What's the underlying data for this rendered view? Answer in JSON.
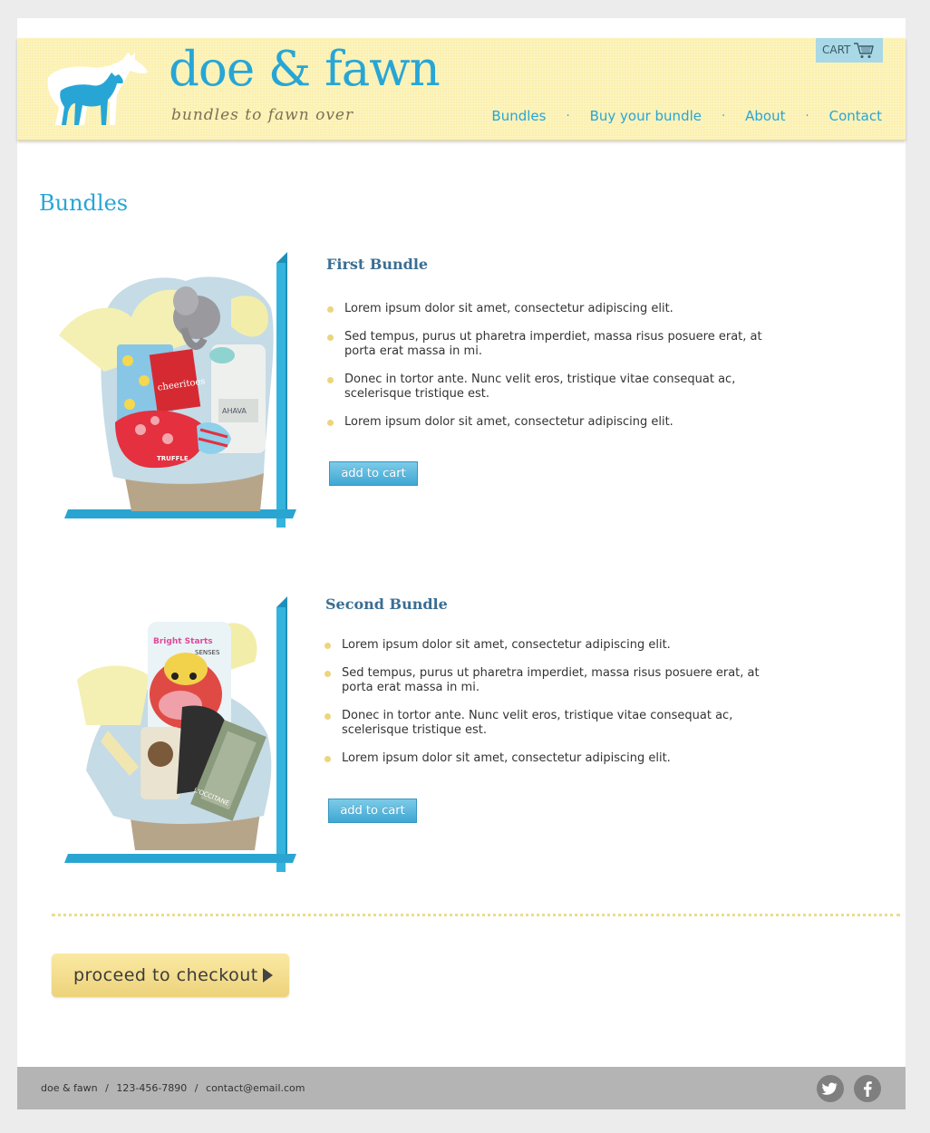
{
  "brand": {
    "name": "doe & fawn",
    "tagline": "bundles to fawn over"
  },
  "cart": {
    "label": "CART",
    "icon": "cart-icon"
  },
  "nav": {
    "items": [
      {
        "label": "Bundles"
      },
      {
        "label": "Buy your bundle"
      },
      {
        "label": "About"
      },
      {
        "label": "Contact"
      }
    ],
    "separator": "·"
  },
  "page_title": "Bundles",
  "bundles": [
    {
      "title": "First Bundle",
      "features": [
        "Lorem ipsum dolor sit amet, consectetur adipiscing elit.",
        "Sed tempus, purus ut pharetra imperdiet, massa risus posuere erat, at porta erat massa in mi.",
        "Donec in tortor ante. Nunc velit eros, tristique vitae consequat ac, scelerisque tristique est.",
        "Lorem ipsum dolor sit amet, consectetur adipiscing elit."
      ],
      "button": "add to cart",
      "image_labels": [
        "cheeritoes",
        "AHAVA",
        "TRUFFLE"
      ]
    },
    {
      "title": "Second Bundle",
      "features": [
        "Lorem ipsum dolor sit amet, consectetur adipiscing elit.",
        "Sed tempus, purus ut pharetra imperdiet, massa risus posuere erat, at porta erat massa in mi.",
        "Donec in tortor ante. Nunc velit eros, tristique vitae consequat ac, scelerisque tristique est.",
        "Lorem ipsum dolor sit amet, consectetur adipiscing elit."
      ],
      "button": "add to cart",
      "image_labels": [
        "Bright Starts",
        "SENSES",
        "L'OCCITANE"
      ]
    }
  ],
  "checkout": {
    "label": "proceed to checkout"
  },
  "footer": {
    "company": "doe & fawn",
    "phone": "123-456-7890",
    "email": "contact@email.com",
    "separator": "/",
    "social": [
      "twitter-icon",
      "facebook-icon"
    ]
  },
  "colors": {
    "accent_blue": "#27a6d6",
    "header_yellow": "#fbf0ae",
    "title_navy": "#3b6e93",
    "footer_gray": "#b4b4b4"
  }
}
